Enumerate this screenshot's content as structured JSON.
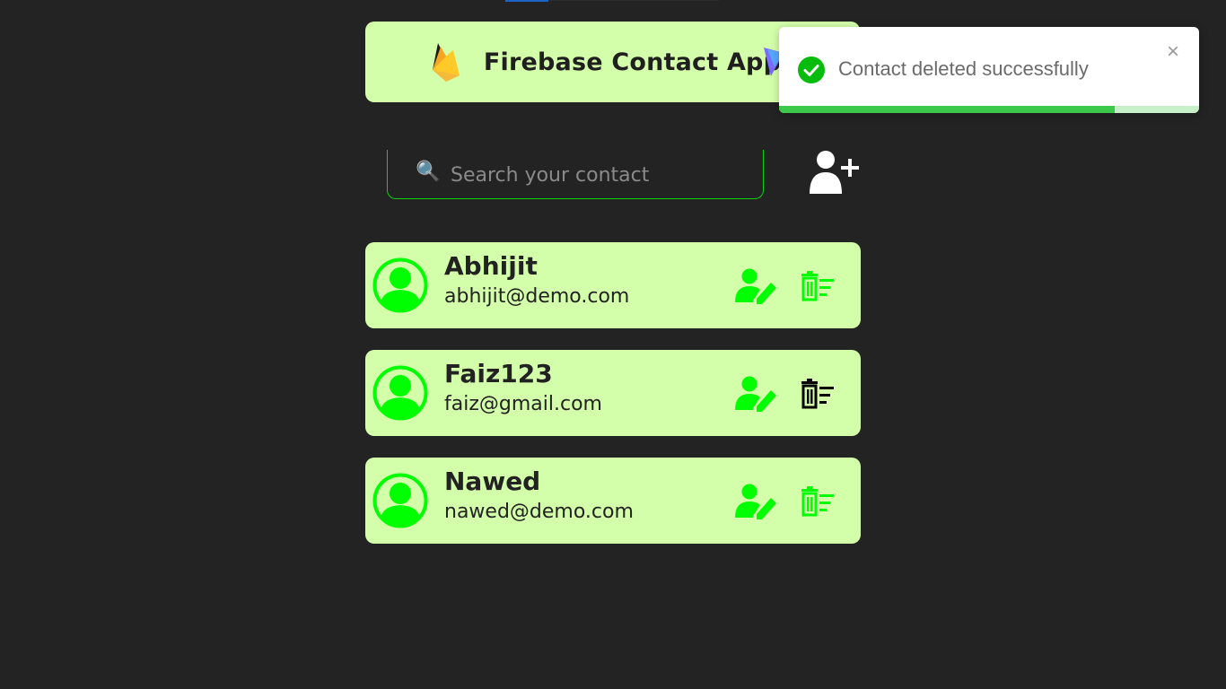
{
  "header": {
    "title": "Firebase Contact App",
    "logo_icon": "firebase-logo"
  },
  "search": {
    "placeholder": "Search your contact",
    "value": "",
    "icon": "magnifier-icon"
  },
  "add_contact_icon": "add-user-icon",
  "contacts": [
    {
      "name": "Abhijit",
      "email": "abhijit@demo.com",
      "delete_icon_color": "#00ff00"
    },
    {
      "name": "Faiz123",
      "email": "faiz@gmail.com",
      "delete_icon_color": "#000000"
    },
    {
      "name": "Nawed",
      "email": "nawed@demo.com",
      "delete_icon_color": "#00ff00"
    }
  ],
  "toast": {
    "message": "Contact deleted successfully",
    "close_label": "×",
    "progress": 0.8,
    "status_color": "#07bc0c"
  },
  "colors": {
    "background": "#232323",
    "card": "#d4ffaa",
    "accent": "#00ff00"
  }
}
